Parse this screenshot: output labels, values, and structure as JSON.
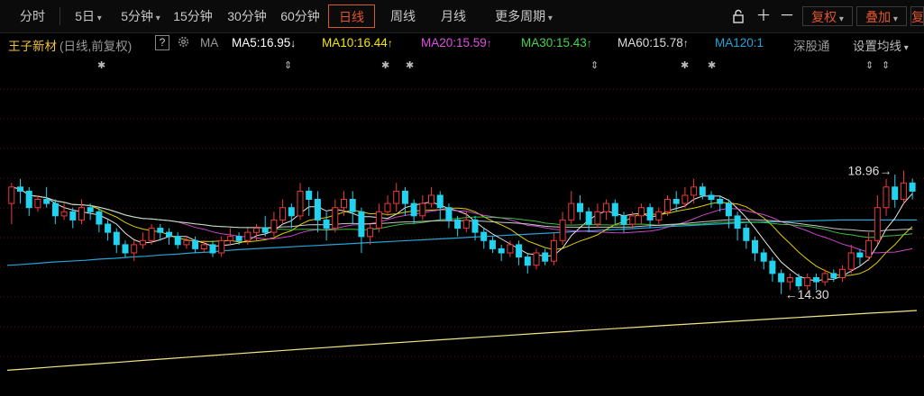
{
  "toolbar": {
    "periods": [
      "分时",
      "5日",
      "5分钟",
      "15分钟",
      "30分钟",
      "60分钟",
      "日线",
      "周线",
      "月线",
      "更多周期"
    ],
    "selected_period": "日线",
    "right_buttons": {
      "adjust": "复权",
      "overlay": "叠加",
      "extra": "复"
    },
    "lock_icon": "lock-icon",
    "zoom_in_icon": "plus-icon",
    "zoom_out_icon": "minus-icon"
  },
  "info": {
    "stock_name": "王子新材",
    "mode": "(日线,前复权)",
    "help": "?",
    "ma_label": "MA",
    "ma5": "MA5:16.95",
    "ma10": "MA10:16.44",
    "ma20": "MA20:15.59",
    "ma30": "MA30:15.43",
    "ma60": "MA60:15.78",
    "ma120": "MA120:1",
    "exchange": "深股通",
    "settings": "设置均线",
    "arrows": {
      "ma5": "↓",
      "ma10": "↑",
      "ma20": "↑",
      "ma30": "↑",
      "ma60": "↑"
    }
  },
  "colors": {
    "up": "#ee3a3a",
    "down": "#21d3ef",
    "accent": "#e2542c",
    "ma5": "#ffffff",
    "ma10": "#f5e600",
    "ma20": "#e04ee0",
    "ma30": "#46d44a",
    "ma60": "#dddddd",
    "ma120": "#22a5d6",
    "ma250": "#f2e585"
  },
  "chart_data": {
    "type": "candlestick",
    "ylim": [
      12.0,
      20.0
    ],
    "high_label": "18.96",
    "low_label": "14.30",
    "high_value": 18.96,
    "low_value": 14.3,
    "candles": [
      [
        16.5,
        16.9,
        17.0,
        16.0
      ],
      [
        16.9,
        16.8,
        17.1,
        16.5
      ],
      [
        16.8,
        16.4,
        16.9,
        16.2
      ],
      [
        16.4,
        16.6,
        16.7,
        16.3
      ],
      [
        16.6,
        16.5,
        16.9,
        16.4
      ],
      [
        16.5,
        16.2,
        16.6,
        16.0
      ],
      [
        16.2,
        16.3,
        16.5,
        16.1
      ],
      [
        16.3,
        16.1,
        16.4,
        15.9
      ],
      [
        16.1,
        16.4,
        16.6,
        16.0
      ],
      [
        16.4,
        16.3,
        16.5,
        16.1
      ],
      [
        16.3,
        16.0,
        16.4,
        15.8
      ],
      [
        16.0,
        15.8,
        16.1,
        15.6
      ],
      [
        15.8,
        15.5,
        15.9,
        15.3
      ],
      [
        15.5,
        15.3,
        15.6,
        15.2
      ],
      [
        15.3,
        15.5,
        15.6,
        15.1
      ],
      [
        15.5,
        15.6,
        15.8,
        15.4
      ],
      [
        15.6,
        15.9,
        16.0,
        15.5
      ],
      [
        15.9,
        15.8,
        16.0,
        15.6
      ],
      [
        15.8,
        15.7,
        15.9,
        15.5
      ],
      [
        15.7,
        15.5,
        15.8,
        15.4
      ],
      [
        15.5,
        15.6,
        15.7,
        15.4
      ],
      [
        15.6,
        15.4,
        15.7,
        15.3
      ],
      [
        15.4,
        15.5,
        15.6,
        15.3
      ],
      [
        15.5,
        15.3,
        15.6,
        15.2
      ],
      [
        15.3,
        15.6,
        15.7,
        15.2
      ],
      [
        15.6,
        15.7,
        15.9,
        15.5
      ],
      [
        15.7,
        15.6,
        15.8,
        15.5
      ],
      [
        15.6,
        15.8,
        15.9,
        15.5
      ],
      [
        15.8,
        15.9,
        16.0,
        15.6
      ],
      [
        15.9,
        15.8,
        16.2,
        15.7
      ],
      [
        15.8,
        16.1,
        16.3,
        15.7
      ],
      [
        16.1,
        16.4,
        16.6,
        16.0
      ],
      [
        16.4,
        16.2,
        16.5,
        15.9
      ],
      [
        16.2,
        16.8,
        17.0,
        16.1
      ],
      [
        16.8,
        16.6,
        16.9,
        16.2
      ],
      [
        16.6,
        16.1,
        16.8,
        15.8
      ],
      [
        16.1,
        15.9,
        16.3,
        15.6
      ],
      [
        15.9,
        16.4,
        16.6,
        15.8
      ],
      [
        16.4,
        16.6,
        16.8,
        16.2
      ],
      [
        16.6,
        16.3,
        16.8,
        16.0
      ],
      [
        16.3,
        15.7,
        16.4,
        15.3
      ],
      [
        15.7,
        15.9,
        16.0,
        15.5
      ],
      [
        15.9,
        16.3,
        16.5,
        15.8
      ],
      [
        16.3,
        16.5,
        16.7,
        16.2
      ],
      [
        16.5,
        16.8,
        17.0,
        16.3
      ],
      [
        16.8,
        16.5,
        16.9,
        16.2
      ],
      [
        16.5,
        16.2,
        16.6,
        16.0
      ],
      [
        16.2,
        16.5,
        16.7,
        16.1
      ],
      [
        16.5,
        16.7,
        16.9,
        16.4
      ],
      [
        16.7,
        16.4,
        16.8,
        16.1
      ],
      [
        16.4,
        16.1,
        16.5,
        15.9
      ],
      [
        16.1,
        15.9,
        16.2,
        15.7
      ],
      [
        15.9,
        16.1,
        16.3,
        15.8
      ],
      [
        16.1,
        15.8,
        16.2,
        15.6
      ],
      [
        15.8,
        15.6,
        15.9,
        15.4
      ],
      [
        15.6,
        15.4,
        15.7,
        15.3
      ],
      [
        15.4,
        15.3,
        15.5,
        15.1
      ],
      [
        15.3,
        15.5,
        15.6,
        15.2
      ],
      [
        15.5,
        15.2,
        15.6,
        15.0
      ],
      [
        15.2,
        15.0,
        15.3,
        14.8
      ],
      [
        15.0,
        15.3,
        15.4,
        14.9
      ],
      [
        15.3,
        15.1,
        15.4,
        15.0
      ],
      [
        15.1,
        15.6,
        15.8,
        15.0
      ],
      [
        15.6,
        16.1,
        16.3,
        15.5
      ],
      [
        16.1,
        16.5,
        16.8,
        16.0
      ],
      [
        16.5,
        16.3,
        16.7,
        16.1
      ],
      [
        16.3,
        16.0,
        16.4,
        15.8
      ],
      [
        16.0,
        16.3,
        16.5,
        15.9
      ],
      [
        16.3,
        16.5,
        16.6,
        16.1
      ],
      [
        16.5,
        16.2,
        16.6,
        16.0
      ],
      [
        16.2,
        16.0,
        16.3,
        15.8
      ],
      [
        16.0,
        16.2,
        16.3,
        15.9
      ],
      [
        16.2,
        16.4,
        16.5,
        16.0
      ],
      [
        16.4,
        16.1,
        16.5,
        15.9
      ],
      [
        16.1,
        16.3,
        16.4,
        16.0
      ],
      [
        16.3,
        16.6,
        16.7,
        16.2
      ],
      [
        16.6,
        16.5,
        16.8,
        16.3
      ],
      [
        16.5,
        16.7,
        16.9,
        16.4
      ],
      [
        16.7,
        16.9,
        17.1,
        16.5
      ],
      [
        16.9,
        16.7,
        17.0,
        16.6
      ],
      [
        16.7,
        16.6,
        16.8,
        16.4
      ],
      [
        16.6,
        16.5,
        16.7,
        16.3
      ],
      [
        16.5,
        16.2,
        16.6,
        15.9
      ],
      [
        16.2,
        15.9,
        16.3,
        15.6
      ],
      [
        15.9,
        15.6,
        16.0,
        15.4
      ],
      [
        15.6,
        15.3,
        15.7,
        15.1
      ],
      [
        15.3,
        15.1,
        15.4,
        14.9
      ],
      [
        15.1,
        14.8,
        15.2,
        14.6
      ],
      [
        14.8,
        14.6,
        14.9,
        14.3
      ],
      [
        14.6,
        14.7,
        14.8,
        14.4
      ],
      [
        14.7,
        14.5,
        14.8,
        14.4
      ],
      [
        14.5,
        14.7,
        14.8,
        14.4
      ],
      [
        14.7,
        14.6,
        14.8,
        14.4
      ],
      [
        14.6,
        14.8,
        14.9,
        14.5
      ],
      [
        14.8,
        14.7,
        14.9,
        14.6
      ],
      [
        14.7,
        14.9,
        15.0,
        14.6
      ],
      [
        14.9,
        15.3,
        15.5,
        14.8
      ],
      [
        15.3,
        15.2,
        15.4,
        15.0
      ],
      [
        15.2,
        15.6,
        15.8,
        15.1
      ],
      [
        15.6,
        16.4,
        16.7,
        15.5
      ],
      [
        16.4,
        16.9,
        17.1,
        16.2
      ],
      [
        16.9,
        16.6,
        17.2,
        16.4
      ],
      [
        16.6,
        17.0,
        17.3,
        16.5
      ],
      [
        17.0,
        16.8,
        17.1,
        16.6
      ]
    ],
    "ma120": [
      15.0,
      15.02,
      15.05,
      15.08,
      15.1,
      15.12,
      15.15,
      15.17,
      15.2,
      15.22,
      15.25,
      15.27,
      15.3,
      15.32,
      15.35,
      15.38,
      15.4,
      15.42,
      15.44,
      15.46,
      15.48,
      15.5,
      15.52,
      15.54,
      15.56,
      15.58,
      15.6,
      15.62,
      15.64,
      15.66,
      15.68,
      15.7,
      15.72,
      15.74,
      15.76,
      15.78,
      15.8,
      15.82,
      15.84,
      15.86,
      15.88,
      15.9,
      15.92,
      15.94,
      15.96,
      15.98,
      16.0,
      16.02,
      16.04,
      16.05,
      16.06,
      16.07,
      16.08,
      16.09,
      16.1,
      16.1,
      16.1,
      16.1,
      16.1,
      16.1
    ]
  }
}
